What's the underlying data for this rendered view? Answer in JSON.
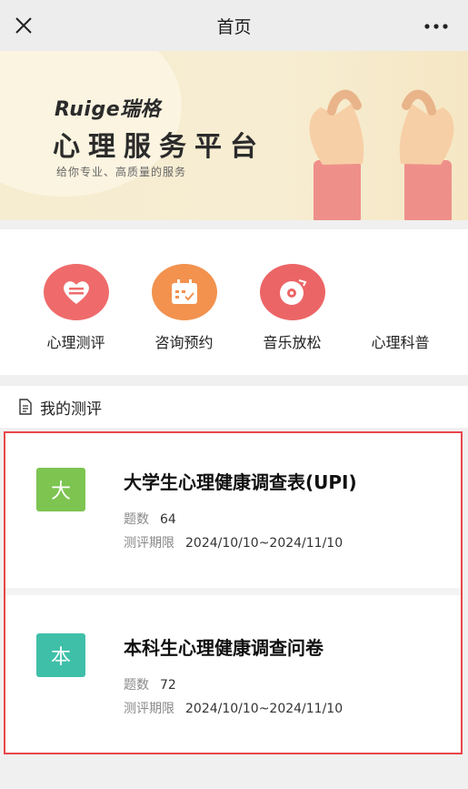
{
  "header": {
    "title": "首页",
    "close_icon": "close-icon",
    "more_icon": "more-horizontal-icon"
  },
  "banner": {
    "brand": "Ruige瑞格",
    "headline": "心理服务平台",
    "subtitle": "给你专业、高质量的服务"
  },
  "menu": [
    {
      "label": "心理测评",
      "icon": "heart-list-icon",
      "color": "#ef6b6b"
    },
    {
      "label": "咨询预约",
      "icon": "calendar-icon",
      "color": "#f2924e"
    },
    {
      "label": "音乐放松",
      "icon": "music-disc-icon",
      "color": "#ec6566"
    },
    {
      "label": "心理科普",
      "icon": "",
      "color": ""
    }
  ],
  "section": {
    "label": "我的测评",
    "icon": "document-icon"
  },
  "assessments": [
    {
      "badge": "大",
      "badge_color": "#7dc451",
      "title": "大学生心理健康调查表(UPI)",
      "count_label": "题数",
      "count": "64",
      "period_label": "测评期限",
      "period": "2024/10/10~2024/11/10"
    },
    {
      "badge": "本",
      "badge_color": "#3fbfa8",
      "title": "本科生心理健康调查问卷",
      "count_label": "题数",
      "count": "72",
      "period_label": "测评期限",
      "period": "2024/10/10~2024/11/10"
    }
  ],
  "colors": {
    "highlight_border": "#e8474b"
  }
}
